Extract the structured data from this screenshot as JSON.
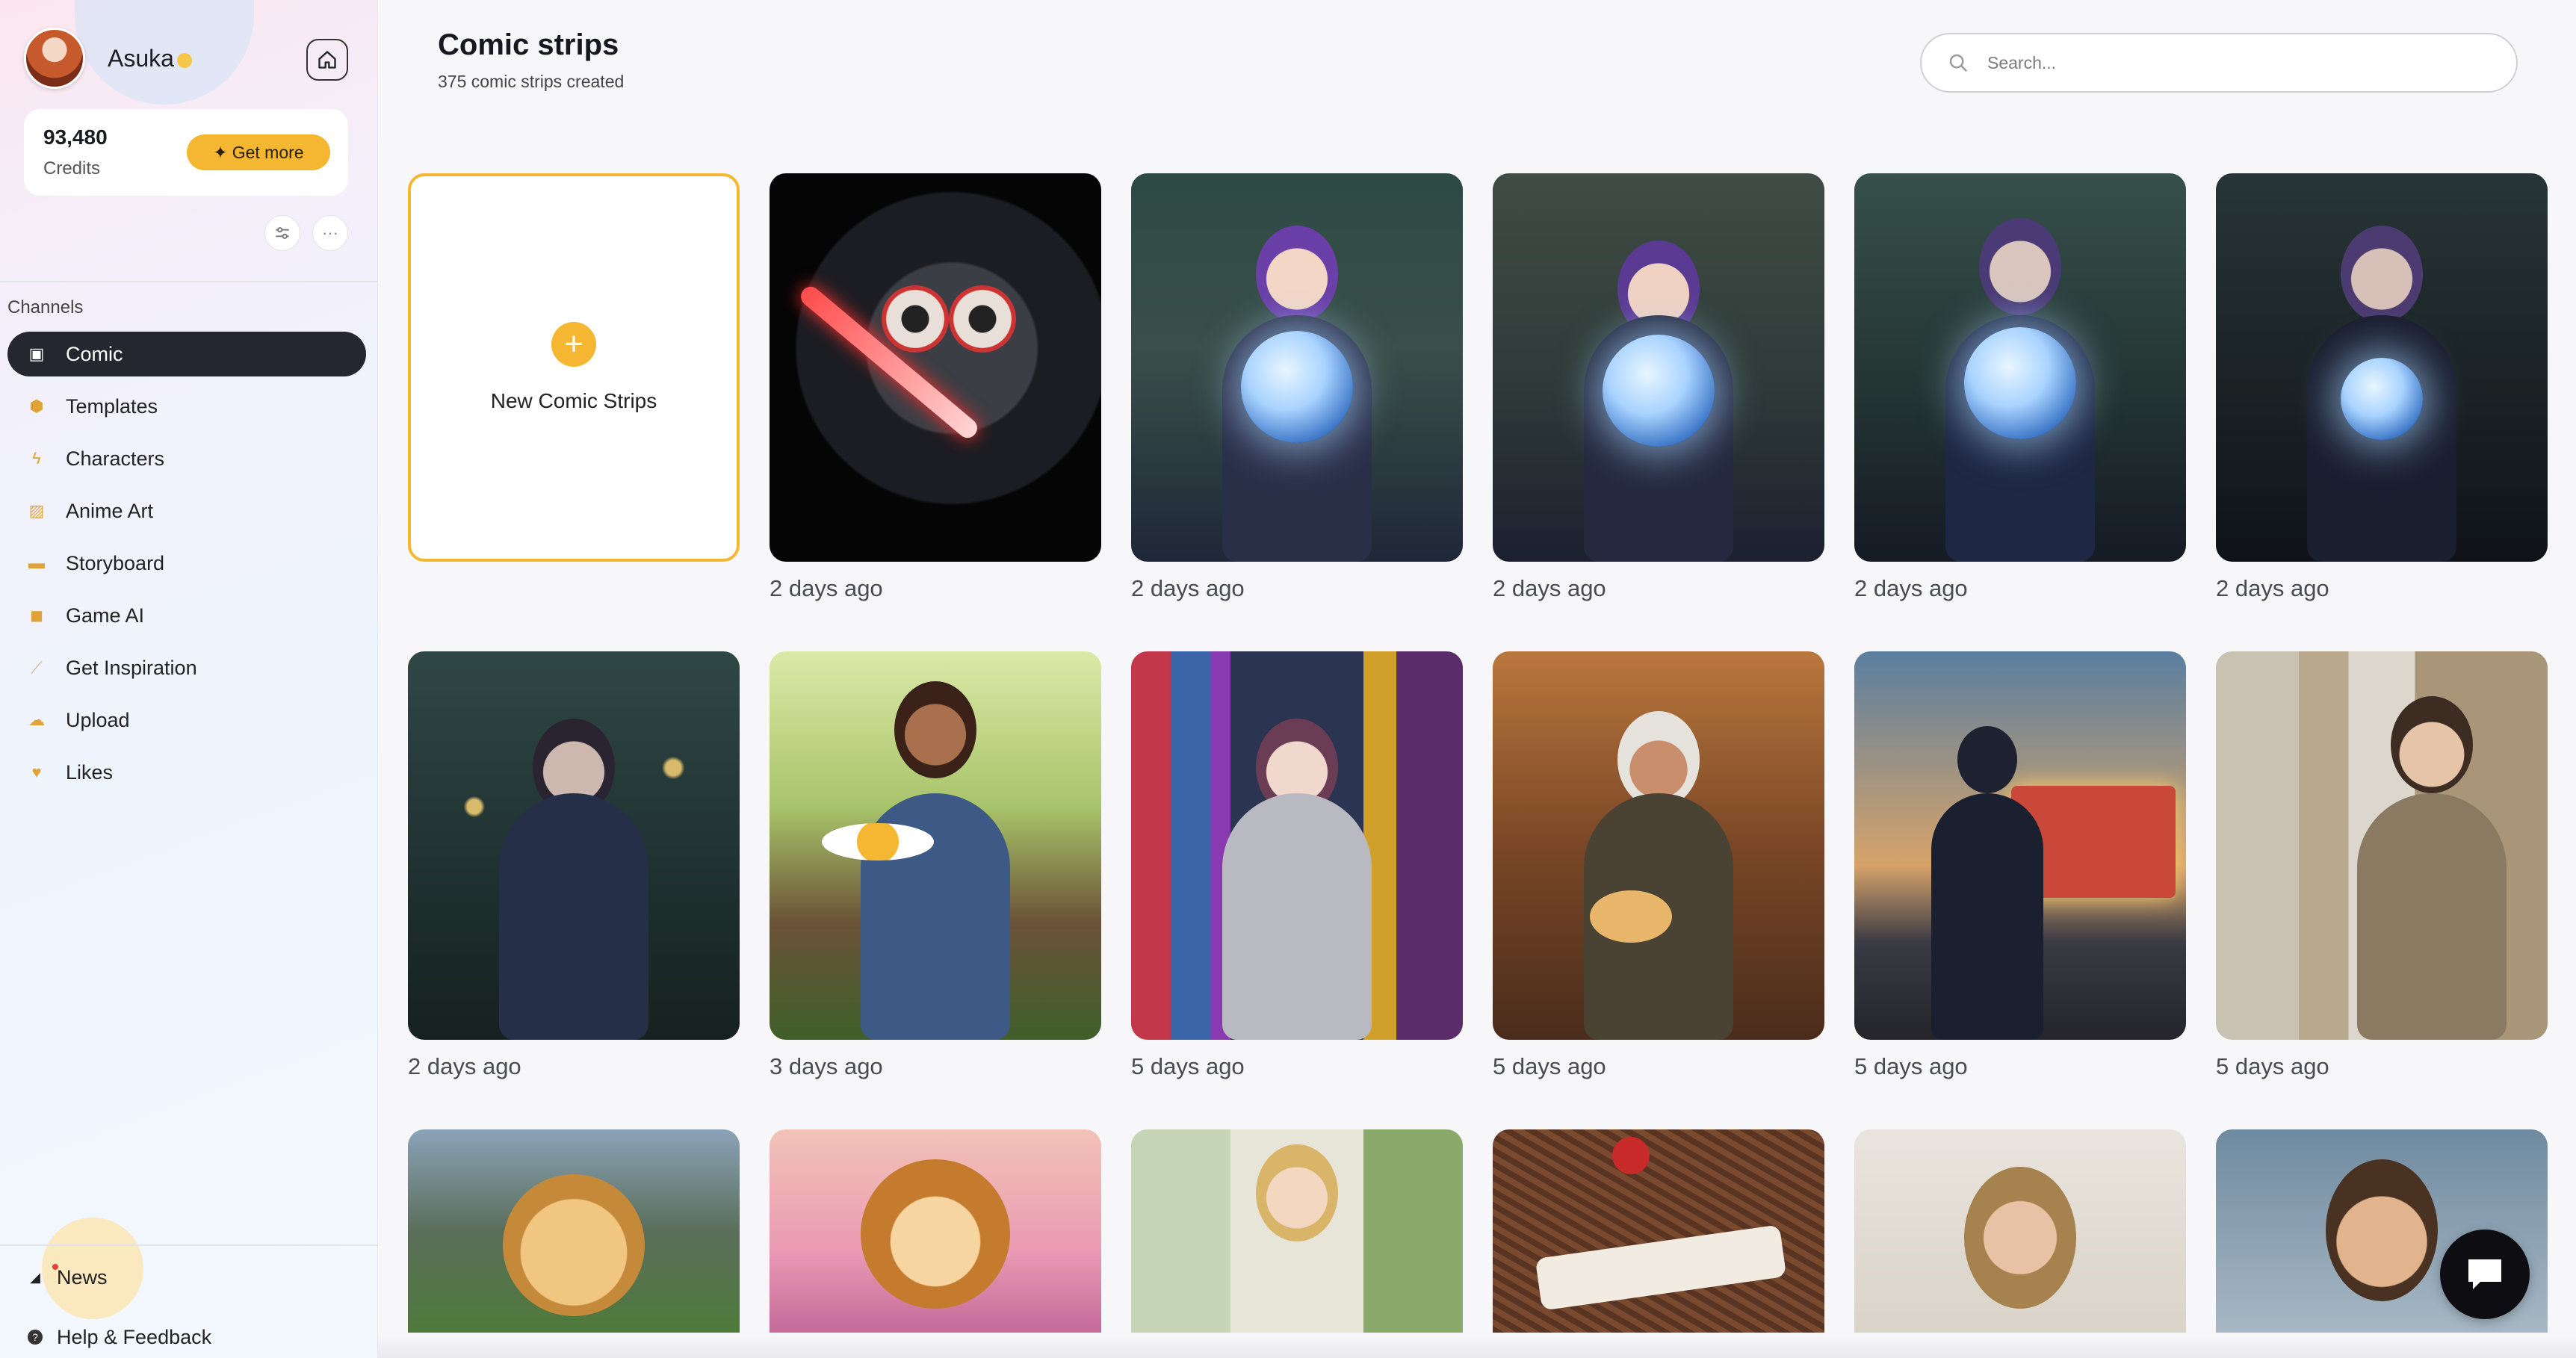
{
  "user": {
    "name": "Asuka",
    "credits_value": "93,480",
    "credits_label": "Credits",
    "get_more": "Get more"
  },
  "sidebar": {
    "section_label": "Channels",
    "items": [
      {
        "label": "Comic",
        "icon": "clapper-icon",
        "active": true
      },
      {
        "label": "Templates",
        "icon": "box-icon"
      },
      {
        "label": "Characters",
        "icon": "lightning-icon"
      },
      {
        "label": "Anime Art",
        "icon": "image-icon"
      },
      {
        "label": "Storyboard",
        "icon": "folder-icon"
      },
      {
        "label": "Game AI",
        "icon": "gamepad-icon"
      },
      {
        "label": "Get Inspiration",
        "icon": "wand-icon"
      },
      {
        "label": "Upload",
        "icon": "cloud-icon"
      },
      {
        "label": "Likes",
        "icon": "heart-icon"
      }
    ],
    "bottom": [
      {
        "label": "News",
        "icon": "megaphone-icon"
      },
      {
        "label": "Help & Feedback",
        "icon": "help-icon"
      }
    ]
  },
  "header": {
    "title": "Comic strips",
    "subtitle": "375 comic strips created"
  },
  "search": {
    "placeholder": "Search..."
  },
  "new_card": {
    "label": "New Comic Strips"
  },
  "cards_row1": [
    {
      "time": "2 days ago"
    },
    {
      "time": "2 days ago"
    },
    {
      "time": "2 days ago"
    },
    {
      "time": "2 days ago"
    },
    {
      "time": "2 days ago"
    }
  ],
  "cards_row2": [
    {
      "time": "2 days ago"
    },
    {
      "time": "3 days ago"
    },
    {
      "time": "5 days ago"
    },
    {
      "time": "5 days ago"
    },
    {
      "time": "5 days ago"
    },
    {
      "time": "5 days ago"
    }
  ],
  "colors": {
    "accent": "#f5b731",
    "active_nav": "#262630"
  }
}
